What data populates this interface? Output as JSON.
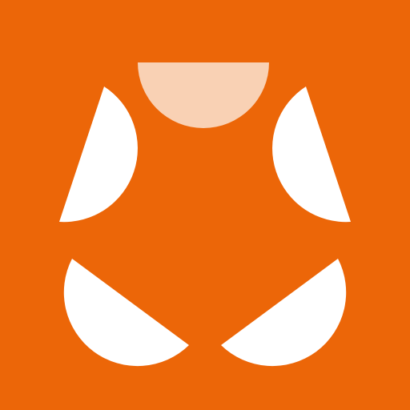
{
  "icon": {
    "name": "pentagon-segments-logo-icon",
    "background_color": "#EC6608",
    "segment_color": "#FFFFFF",
    "highlight_segment_color": "#F9D1B4",
    "segment_count": 5,
    "highlighted_segment": "top"
  }
}
